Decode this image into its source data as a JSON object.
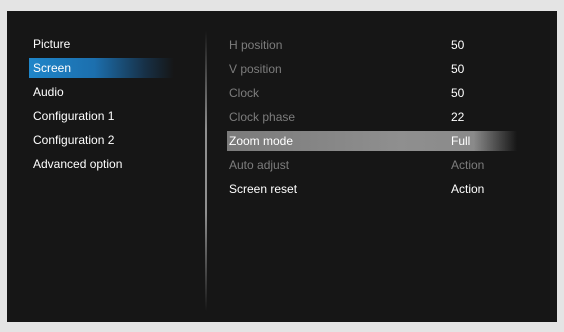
{
  "left_menu": {
    "items": [
      {
        "label": "Picture"
      },
      {
        "label": "Screen"
      },
      {
        "label": "Audio"
      },
      {
        "label": "Configuration 1"
      },
      {
        "label": "Configuration 2"
      },
      {
        "label": "Advanced option"
      }
    ],
    "selected": "Screen"
  },
  "screen_settings": {
    "rows": [
      {
        "label": "H position",
        "value": "50"
      },
      {
        "label": "V position",
        "value": "50"
      },
      {
        "label": "Clock",
        "value": "50"
      },
      {
        "label": "Clock phase",
        "value": "22"
      },
      {
        "label": "Zoom mode",
        "value": "Full"
      },
      {
        "label": "Auto adjust",
        "value": "Action"
      },
      {
        "label": "Screen reset",
        "value": "Action"
      }
    ],
    "selected": "Zoom mode"
  },
  "colors": {
    "background": "#161616",
    "highlight_left": "#1f86c9",
    "highlight_right": "#8f8f8f",
    "text_active": "#ffffff",
    "text_disabled": "#7d7d7d"
  }
}
